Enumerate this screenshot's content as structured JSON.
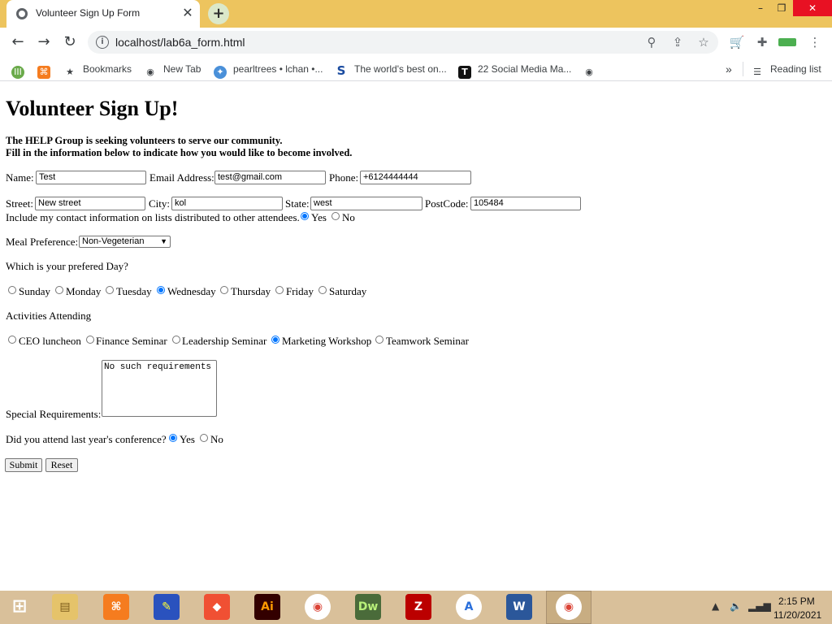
{
  "browser": {
    "tab_title": "Volunteer Sign Up Form",
    "url": "localhost/lab6a_form.html",
    "bookmarks": [
      "Bookmarks",
      "New Tab",
      "pearltrees • lchan •...",
      "The world's best on...",
      "22 Social Media Ma..."
    ],
    "reading_list": "Reading list"
  },
  "page": {
    "heading": "Volunteer Sign Up!",
    "intro_line1": "The HELP Group is seeking volunteers to serve our community.",
    "intro_line2": "Fill in the information below to indicate how you would like to become involved.",
    "labels": {
      "name": "Name:",
      "email": "Email Address:",
      "phone": "Phone:",
      "street": "Street:",
      "city": "City:",
      "state": "State:",
      "postcode": "PostCode:",
      "include_contact": "Include my contact information on lists distributed to other attendees.",
      "meal": "Meal Preference:",
      "day_question": "Which is your prefered Day?",
      "activities": "Activities Attending",
      "special": "Special Requirements:",
      "attended": "Did you attend last year's conference?"
    },
    "values": {
      "name": "Test",
      "email": "test@gmail.com",
      "phone": "+6124444444",
      "street": "New street",
      "city": "kol",
      "state": "west",
      "postcode": "105484",
      "meal": "Non-Vegeterian",
      "special": "No such requirements"
    },
    "yes_label": "Yes",
    "no_label": "No",
    "days": [
      "Sunday",
      "Monday",
      "Tuesday",
      "Wednesday",
      "Thursday",
      "Friday",
      "Saturday"
    ],
    "selected_day": "Wednesday",
    "activity_options": [
      "CEO luncheon",
      "Finance Seminar",
      "Leadership Seminar",
      "Marketing Workshop",
      "Teamwork Seminar"
    ],
    "selected_activity": "Marketing Workshop",
    "include_contact_selected": "Yes",
    "attended_selected": "Yes",
    "submit_label": "Submit",
    "reset_label": "Reset"
  },
  "taskbar": {
    "time": "2:15 PM",
    "date": "11/20/2021"
  }
}
